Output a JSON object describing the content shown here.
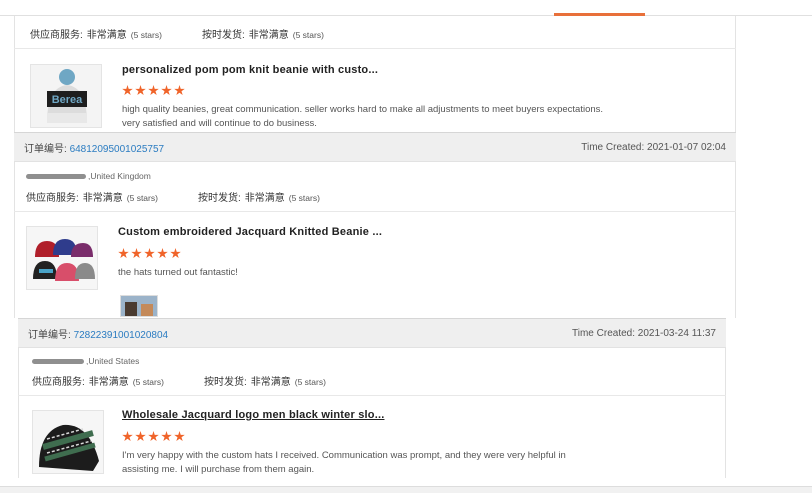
{
  "labels": {
    "supplier_service": "供应商服务:",
    "on_time_shipping": "按时发货:",
    "very_satisfied": "非常满意",
    "five_stars": "(5 stars)",
    "order_no": "订单编号:",
    "time_created": "Time Created:"
  },
  "reviews": [
    {
      "product_title": "personalized pom pom knit beanie with custo...",
      "rating": 5,
      "comment": "high quality beanies, great communication. seller works hard to make all adjustments to meet buyers expectations. very satisfied and will continue to do business.",
      "image_text": "Berea"
    },
    {
      "order_number": "64812095001025757",
      "time_created": "2021-01-07 02:04",
      "buyer_country": "United Kingdom",
      "product_title": "Custom embroidered Jacquard Knitted Beanie ...",
      "rating": 5,
      "comment": "the hats turned out fantastic!"
    },
    {
      "order_number": "72822391001020804",
      "time_created": "2021-03-24 11:37",
      "buyer_country": "United States",
      "product_title": "Wholesale Jacquard logo men black winter slo...",
      "rating": 5,
      "comment": "I'm very happy with the custom hats I received. Communication was prompt, and they were very helpful in assisting me. I will purchase from them again."
    }
  ],
  "colors": {
    "accent": "#e8703a",
    "star": "#f0642a",
    "order_link": "#2b7cc1"
  }
}
